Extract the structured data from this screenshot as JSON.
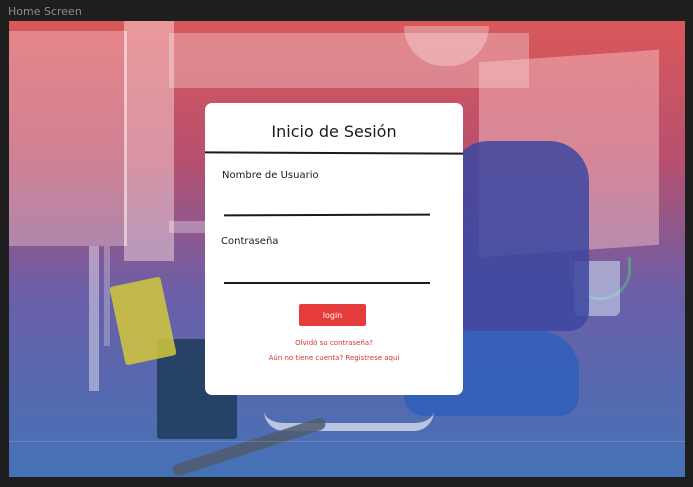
{
  "frame": {
    "label": "Home Screen"
  },
  "login": {
    "title": "Inicio de Sesión",
    "username_label": "Nombre de Usuario",
    "username_value": "",
    "password_label": "Contraseña",
    "password_value": "",
    "submit_label": "login",
    "forgot_link": "Olvidó su contraseña?",
    "register_link": "Aún no tiene cuenta? Registrese aquí"
  },
  "colors": {
    "accent": "#e63b3b",
    "gradient_top": "#d9585a",
    "gradient_bottom": "#4472b6"
  }
}
